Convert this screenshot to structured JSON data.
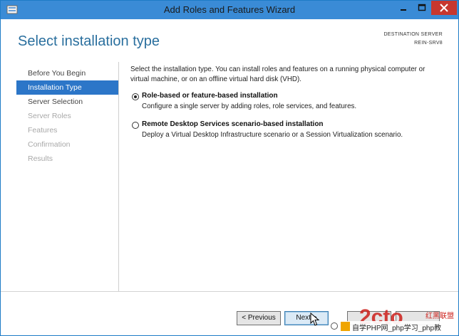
{
  "window": {
    "title": "Add Roles and Features Wizard",
    "titlebar_color": "#3a8bd6",
    "close_color": "#c7372f",
    "controls": {
      "minimize_icon": "minimize-icon",
      "maximize_icon": "maximize-icon",
      "close_icon": "close-icon"
    }
  },
  "header": {
    "page_title": "Select installation type",
    "destination_label": "DESTINATION SERVER",
    "destination_server": "REIN-SRV8"
  },
  "sidebar": {
    "accent_color": "#2c76c8",
    "items": [
      {
        "label": "Before You Begin",
        "state": "normal"
      },
      {
        "label": "Installation Type",
        "state": "active"
      },
      {
        "label": "Server Selection",
        "state": "normal"
      },
      {
        "label": "Server Roles",
        "state": "disabled"
      },
      {
        "label": "Features",
        "state": "disabled"
      },
      {
        "label": "Confirmation",
        "state": "disabled"
      },
      {
        "label": "Results",
        "state": "disabled"
      }
    ]
  },
  "main": {
    "intro": "Select the installation type. You can install roles and features on a running physical computer or virtual machine, or on an offline virtual hard disk (VHD).",
    "options": [
      {
        "label": "Role-based or feature-based installation",
        "description": "Configure a single server by adding roles, role services, and features.",
        "selected": true
      },
      {
        "label": "Remote Desktop Services scenario-based installation",
        "description": "Deploy a Virtual Desktop Infrastructure scenario or a Session Virtualization scenario.",
        "selected": false
      }
    ]
  },
  "footer": {
    "previous_label": "< Previous",
    "next_label": "Next >"
  },
  "watermark": {
    "text1": "红黑联盟",
    "text2": "自学PHP网_php学习_php教"
  }
}
